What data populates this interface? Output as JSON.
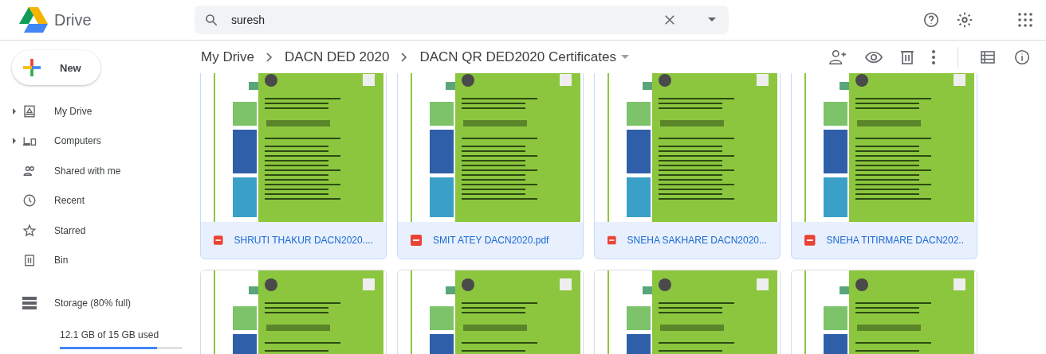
{
  "header": {
    "app_name": "Drive",
    "search": {
      "value": "suresh"
    }
  },
  "new_button": {
    "label": "New"
  },
  "breadcrumb": [
    "My Drive",
    "DACN DED 2020",
    "DACN QR DED2020 Certificates"
  ],
  "sidebar": {
    "items": [
      {
        "label": "My Drive",
        "kind": "drive",
        "expandable": true
      },
      {
        "label": "Computers",
        "kind": "computers",
        "expandable": true
      },
      {
        "label": "Shared with me",
        "kind": "shared",
        "expandable": false
      },
      {
        "label": "Recent",
        "kind": "recent",
        "expandable": false
      },
      {
        "label": "Starred",
        "kind": "starred",
        "expandable": false
      },
      {
        "label": "Bin",
        "kind": "bin",
        "expandable": false
      }
    ],
    "storage": {
      "label": "Storage (80% full)",
      "usage": "12.1 GB of 15 GB used",
      "level": 0.8
    }
  },
  "files": [
    {
      "name": "SHRUTI THAKUR DACN2020....",
      "selected": true
    },
    {
      "name": "SMIT ATEY DACN2020.pdf",
      "selected": true
    },
    {
      "name": "SNEHA SAKHARE DACN2020...",
      "selected": true
    },
    {
      "name": "SNEHA TITIRMARE DACN202..",
      "selected": true
    },
    {
      "selected": false
    },
    {
      "selected": false
    },
    {
      "selected": false
    },
    {
      "selected": false
    }
  ]
}
